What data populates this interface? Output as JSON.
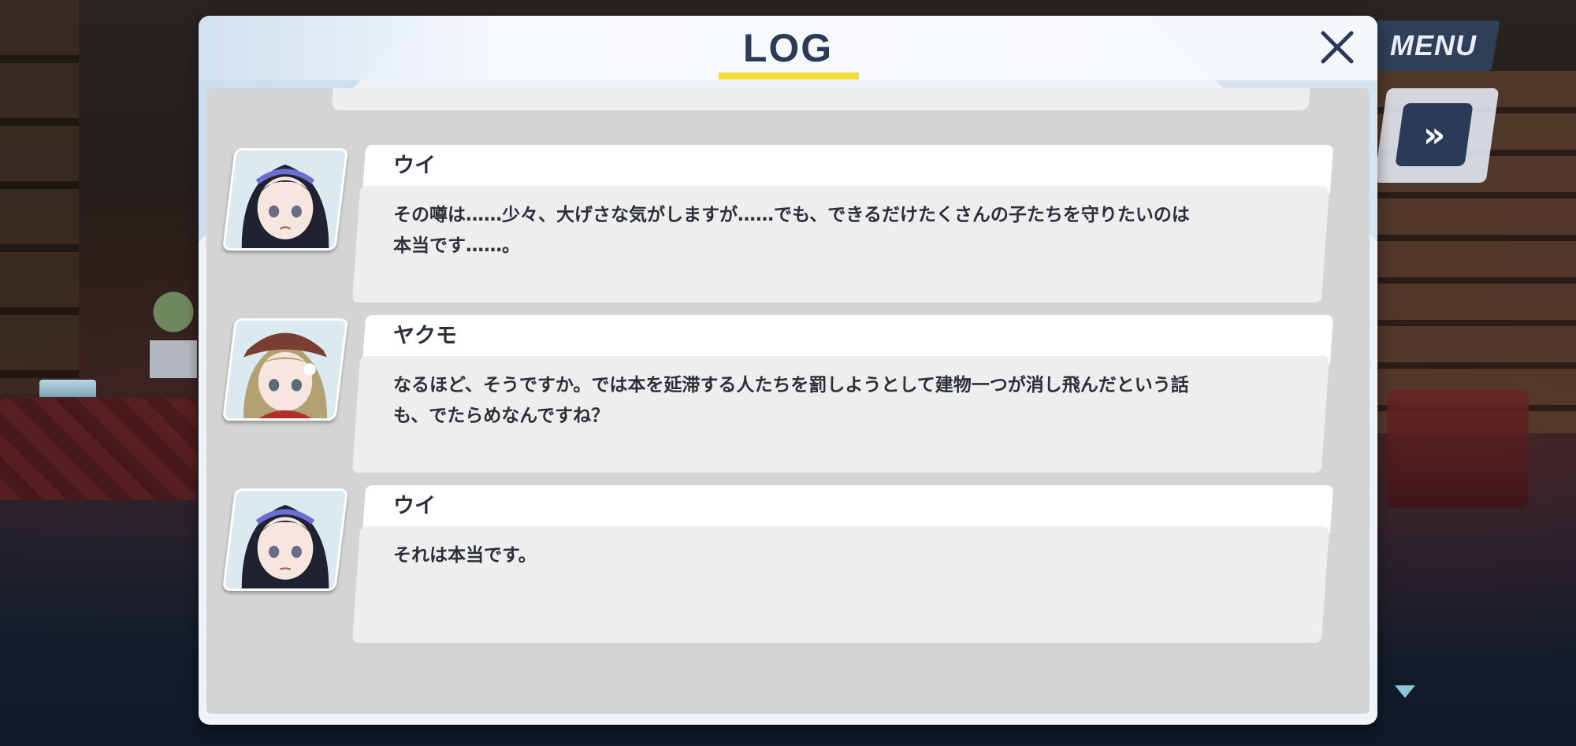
{
  "header": {
    "title": "LOG",
    "menu_label": "MENU",
    "fast_forward_symbol": "»",
    "close_symbol": "✕"
  },
  "colors": {
    "title": "#2a3b58",
    "underline_accent": "#f0dc3a",
    "log_background": "#d4d4d2",
    "bubble": "#eeeeee",
    "name_tab": "#ffffff"
  },
  "entries": [
    {
      "speaker": "ウイ",
      "text": "その噂は……少々、大げさな気がしますが……でも、できるだけたくさんの子たちを守りたいのは本当です……。",
      "avatar_icon": "ui-portrait-icon"
    },
    {
      "speaker": "ヤクモ",
      "text": "なるほど、そうですか。では本を延滞する人たちを罰しようとして建物一つが消し飛んだという話も、でたらめなんですね？",
      "avatar_icon": "yakumo-portrait-icon"
    },
    {
      "speaker": "ウイ",
      "text": "それは本当です。",
      "avatar_icon": "ui-portrait-icon"
    }
  ]
}
